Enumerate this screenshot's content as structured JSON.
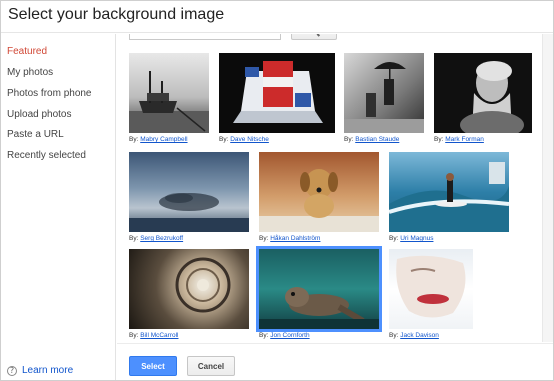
{
  "dialog": {
    "title": "Select your background image"
  },
  "sidebar": {
    "items": [
      {
        "label": "Featured",
        "active": true
      },
      {
        "label": "My photos",
        "active": false
      },
      {
        "label": "Photos from phone",
        "active": false
      },
      {
        "label": "Upload photos",
        "active": false
      },
      {
        "label": "Paste a URL",
        "active": false
      },
      {
        "label": "Recently selected",
        "active": false
      }
    ],
    "learn_more": "Learn more",
    "help_icon": "?"
  },
  "search": {
    "placeholder": ""
  },
  "gallery": {
    "prefix": "By:",
    "items": [
      {
        "author": "Mabry Campbell",
        "subject": "ship-at-pier-bw",
        "selected": false
      },
      {
        "author": "Dave Nitsche",
        "subject": "laptop-popcorn-box",
        "selected": false
      },
      {
        "author": "Bastian Staude",
        "subject": "umbrella-people-bw",
        "selected": false
      },
      {
        "author": "Mark Forman",
        "subject": "old-man-portrait-bw",
        "selected": false
      },
      {
        "author": "Serg Bezrukoff",
        "subject": "bird-flock-sky",
        "selected": false
      },
      {
        "author": "Håkan Dahlström",
        "subject": "puppy-dog",
        "selected": false
      },
      {
        "author": "Uri Magnus",
        "subject": "surfer-wave",
        "selected": false
      },
      {
        "author": "Bill McCarroll",
        "subject": "spiral-staircase",
        "selected": false
      },
      {
        "author": "Jon Cornforth",
        "subject": "sea-lion-underwater",
        "selected": true
      },
      {
        "author": "Jack Davison",
        "subject": "face-closeup",
        "selected": false
      }
    ]
  },
  "footer": {
    "select_label": "Select",
    "cancel_label": "Cancel"
  },
  "colors": {
    "accent": "#4d90fe",
    "featured": "#d14836",
    "link": "#1155cc"
  }
}
